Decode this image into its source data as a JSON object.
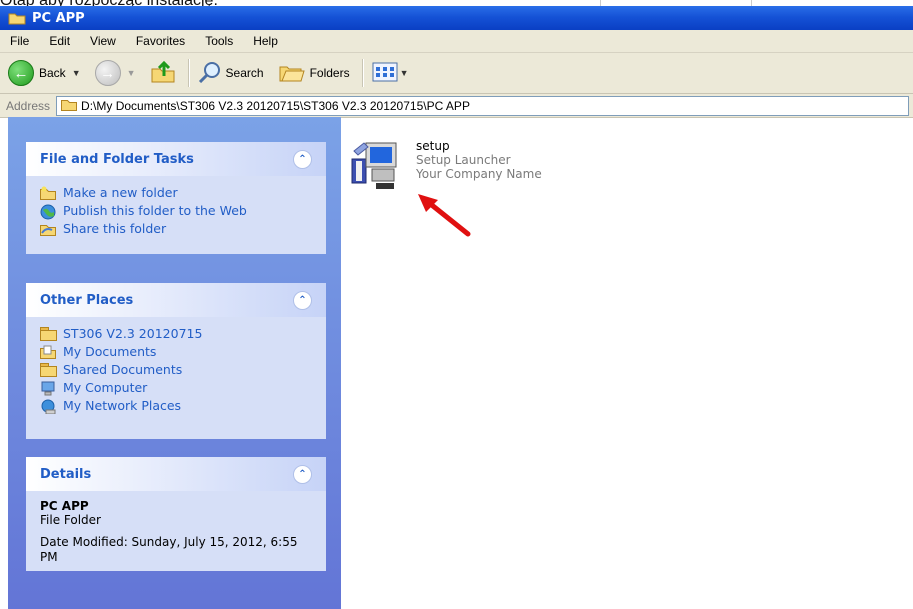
{
  "caption": "Otap aby rozpocząć instalację.",
  "window": {
    "title": "PC APP"
  },
  "menu": [
    "File",
    "Edit",
    "View",
    "Favorites",
    "Tools",
    "Help"
  ],
  "toolbar": {
    "back": "Back",
    "search": "Search",
    "folders": "Folders"
  },
  "address": {
    "label": "Address",
    "path": "D:\\My Documents\\ST306 V2.3 20120715\\ST306 V2.3 20120715\\PC APP"
  },
  "panels": {
    "tasks": {
      "title": "File and Folder Tasks",
      "items": [
        "Make a new folder",
        "Publish this folder to the Web",
        "Share this folder"
      ]
    },
    "places": {
      "title": "Other Places",
      "items": [
        "ST306 V2.3 20120715",
        "My Documents",
        "Shared Documents",
        "My Computer",
        "My Network Places"
      ]
    },
    "details": {
      "title": "Details",
      "name": "PC APP",
      "type": "File Folder",
      "modified": "Date Modified: Sunday, July 15, 2012, 6:55 PM"
    }
  },
  "file": {
    "name": "setup",
    "description": "Setup Launcher",
    "company": "Your Company Name"
  },
  "colors": {
    "titlebar": "#0a3fc4",
    "taskpane": "#6375d6",
    "link": "#215dc6",
    "arrow": "#e01010"
  }
}
